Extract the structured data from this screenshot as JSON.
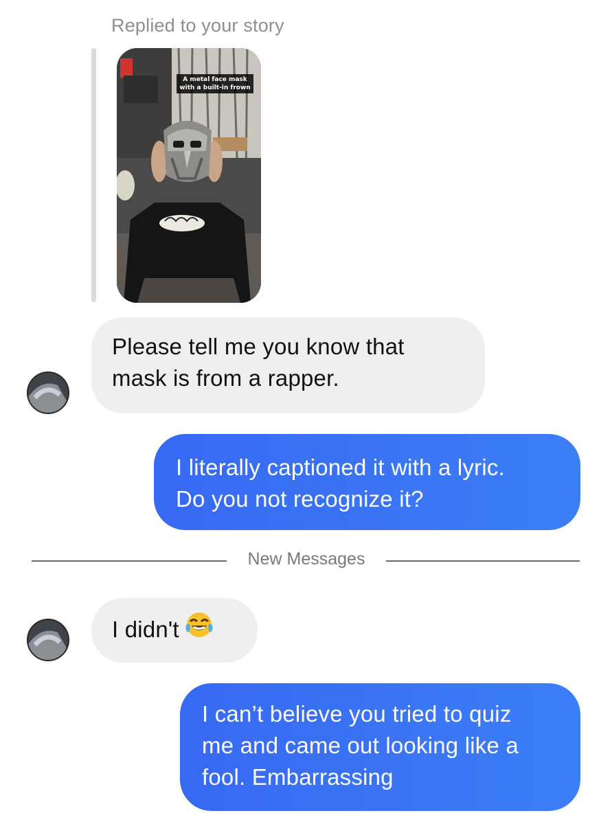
{
  "story_reply": {
    "label": "Replied to your story",
    "caption_line1": "A metal face mask",
    "caption_line2": "with a built-in frown"
  },
  "messages": [
    {
      "direction": "incoming",
      "lines": [
        "Please tell me you know that",
        "mask is from a rapper."
      ]
    },
    {
      "direction": "outgoing",
      "lines": [
        "I literally captioned it with a lyric.",
        "Do you not recognize it?"
      ]
    },
    {
      "direction": "incoming",
      "text": "I didn't",
      "emoji": "face-with-tears-of-joy-icon"
    },
    {
      "direction": "outgoing",
      "lines": [
        "I can’t believe you tried to quiz",
        "me and came out looking like a",
        "fool. Embarrassing"
      ]
    }
  ],
  "divider": {
    "label": "New Messages"
  },
  "colors": {
    "incoming_bubble": "#efefef",
    "outgoing_bubble_start": "#3769f3",
    "outgoing_bubble_end": "#3c7ef6",
    "muted_text": "#8e8e8e",
    "reply_bar": "#dbdbdb"
  }
}
